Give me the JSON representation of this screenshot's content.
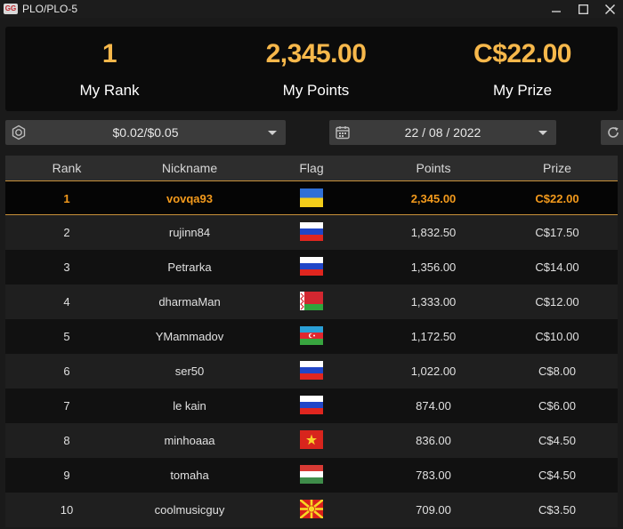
{
  "window": {
    "logo_text": "GG",
    "title": "PLO/PLO-5"
  },
  "summary": {
    "rank": {
      "value": "1",
      "label": "My Rank"
    },
    "points": {
      "value": "2,345.00",
      "label": "My Points"
    },
    "prize": {
      "value": "C$22.00",
      "label": "My Prize"
    }
  },
  "filters": {
    "stakes": {
      "value": "$0.02/$0.05",
      "icon": "chip-icon"
    },
    "date": {
      "value": "22 / 08 / 2022",
      "icon": "calendar-icon"
    },
    "refresh_icon": "refresh-icon"
  },
  "colors": {
    "accent": "#f7b84b",
    "highlight_text": "#f39a1c",
    "highlight_border": "#c8913a"
  },
  "table": {
    "columns": [
      "Rank",
      "Nickname",
      "Flag",
      "Points",
      "Prize"
    ],
    "rows": [
      {
        "rank": "1",
        "nickname": "vovqa93",
        "flag": "ukraine",
        "points": "2,345.00",
        "prize": "C$22.00",
        "highlight": true
      },
      {
        "rank": "2",
        "nickname": "rujinn84",
        "flag": "russia",
        "points": "1,832.50",
        "prize": "C$17.50"
      },
      {
        "rank": "3",
        "nickname": "Petrarka",
        "flag": "russia",
        "points": "1,356.00",
        "prize": "C$14.00"
      },
      {
        "rank": "4",
        "nickname": "dharmaMan",
        "flag": "belarus",
        "points": "1,333.00",
        "prize": "C$12.00"
      },
      {
        "rank": "5",
        "nickname": "YMammadov",
        "flag": "azerbaijan",
        "points": "1,172.50",
        "prize": "C$10.00"
      },
      {
        "rank": "6",
        "nickname": "ser50",
        "flag": "russia",
        "points": "1,022.00",
        "prize": "C$8.00"
      },
      {
        "rank": "7",
        "nickname": "le kain",
        "flag": "russia",
        "points": "874.00",
        "prize": "C$6.00"
      },
      {
        "rank": "8",
        "nickname": "minhoaaa",
        "flag": "vietnam",
        "points": "836.00",
        "prize": "C$4.50"
      },
      {
        "rank": "9",
        "nickname": "tomaha",
        "flag": "hungary",
        "points": "783.00",
        "prize": "C$4.50"
      },
      {
        "rank": "10",
        "nickname": "coolmusicguy",
        "flag": "north-macedonia",
        "points": "709.00",
        "prize": "C$3.50"
      }
    ]
  }
}
